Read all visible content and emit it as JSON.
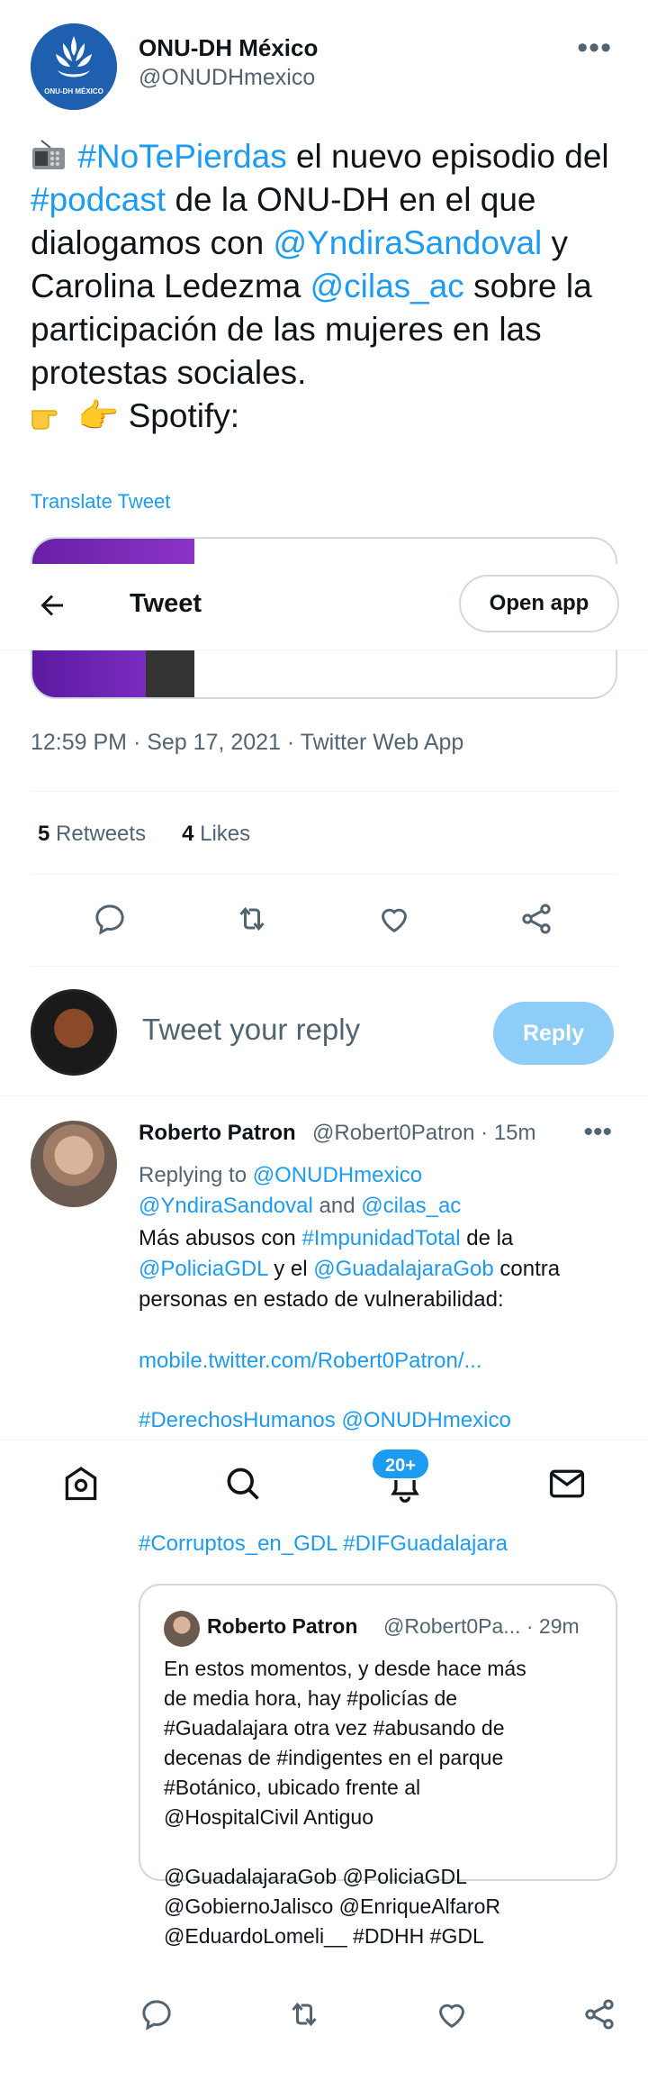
{
  "tweet": {
    "author_name": "ONU-DH México",
    "author_handle": "@ONUDHmexico",
    "avatar_text": "ONU-DH MÉXICO",
    "text_segments": [
      {
        "t": "📻 ",
        "kind": "emoji"
      },
      {
        "t": "#NoTePierdas",
        "kind": "link"
      },
      {
        "t": " el nuevo episodio del ",
        "kind": "text"
      },
      {
        "t": "#podcast",
        "kind": "link"
      },
      {
        "t": " de la ONU-DH en el que dialogamos con ",
        "kind": "text"
      },
      {
        "t": "@YndiraSandoval",
        "kind": "link"
      },
      {
        "t": " y Carolina Ledezma ",
        "kind": "text"
      },
      {
        "t": "@cilas_ac",
        "kind": "link"
      },
      {
        "t": " sobre la participación de las mujeres en las protestas sociales.",
        "kind": "text"
      },
      {
        "t": "👉 Spotify:",
        "kind": "text"
      }
    ],
    "translate_label": "Translate Tweet",
    "timestamp": "12:59 PM · Sep 17, 2021 · Twitter Web App",
    "retweets_count": "5",
    "retweets_label": "Retweets",
    "likes_count": "4",
    "likes_label": "Likes"
  },
  "topbar": {
    "title": "Tweet",
    "open_app_label": "Open app"
  },
  "compose": {
    "placeholder": "Tweet your reply",
    "reply_label": "Reply"
  },
  "reply": {
    "name": "Roberto Patron",
    "handle": "@Robert0Patron",
    "time": "· 15m",
    "replying_to_label": "Replying to",
    "replying_to_1": "@ONUDHmexico",
    "replying_to_2": "@YndiraSandoval",
    "and_label": "and",
    "replying_to_3": "@cilas_ac",
    "body_1a": "Más abusos con ",
    "body_1b": "#ImpunidadTotal",
    "body_1c": " de la",
    "body_2a": "@PoliciaGDL",
    "body_2b": " y el ",
    "body_2c": "@GuadalajaraGob",
    "body_2d": " contra",
    "body_3": "personas en estado de vulnerabilidad:",
    "link": "mobile.twitter.com/Robert0Patron/...",
    "tags_1a": "#DerechosHumanos",
    "tags_1b": "@ONUDHmexico",
    "tags_2": "#Corruptos_en_GDL #DIFGuadalajara"
  },
  "quote": {
    "name": "Roberto Patron",
    "handle": "@Robert0Pa...",
    "time": "· 29m",
    "lines": [
      "En estos momentos, y desde hace más",
      "de media hora, hay #policías de",
      "#Guadalajara otra vez #abusando de",
      "decenas de #indigentes en el parque",
      "#Botánico, ubicado frente al",
      "@HospitalCivil Antiguo",
      "",
      "@GuadalajaraGob @PoliciaGDL",
      "@GobiernoJalisco @EnriqueAlfaroR",
      "@EduardoLomeli__ #DDHH #GDL"
    ]
  },
  "nav": {
    "badge": "20+"
  },
  "colors": {
    "accent": "#1d9bf0",
    "muted": "#536471",
    "reply_button_disabled": "#8ecdf8",
    "border": "#cfd9de"
  },
  "icons": [
    "more-icon",
    "radio-emoji",
    "pointing-hand-emoji",
    "back-arrow-icon",
    "reply-icon",
    "retweet-icon",
    "like-icon",
    "share-icon",
    "home-icon",
    "search-icon",
    "notifications-icon",
    "messages-icon"
  ]
}
